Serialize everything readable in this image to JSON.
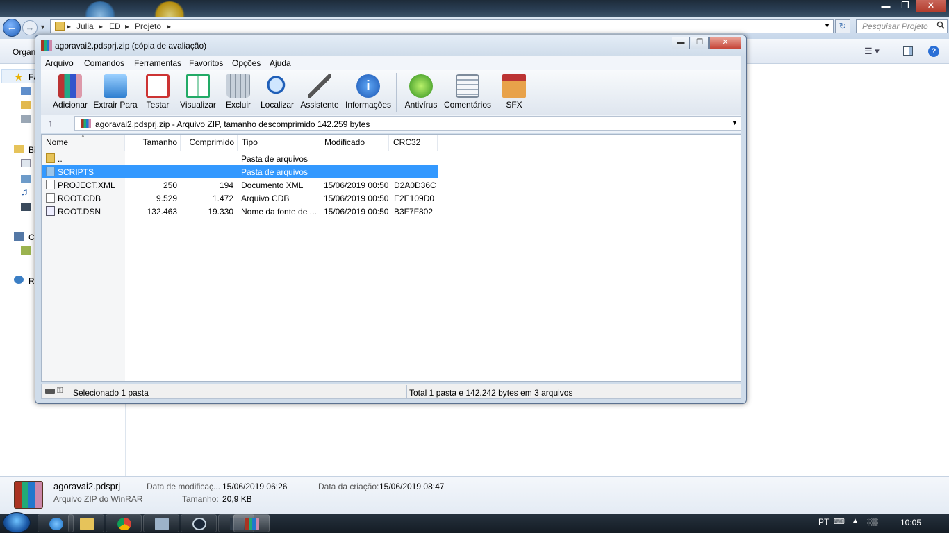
{
  "explorer": {
    "breadcrumbs": [
      "Julia",
      "ED",
      "Projeto"
    ],
    "search_placeholder": "Pesquisar Projeto",
    "organize_label": "Organ",
    "nav_labels": [
      "Fa",
      "Bi",
      "C",
      "Re"
    ],
    "window_controls": {
      "minimize": "▬",
      "maximize": "❐",
      "close": "✕"
    }
  },
  "details": {
    "filename": "agoravai2.pdsprj",
    "filetype": "Arquivo ZIP do WinRAR",
    "mod_label": "Data de modificaç...",
    "mod_value": "15/06/2019 06:26",
    "size_label": "Tamanho:",
    "size_value": "20,9 KB",
    "created_label": "Data da criação:",
    "created_value": "15/06/2019 08:47"
  },
  "winrar": {
    "title": "agoravai2.pdsprj.zip (cópia de avaliação)",
    "menu": [
      "Arquivo",
      "Comandos",
      "Ferramentas",
      "Favoritos",
      "Opções",
      "Ajuda"
    ],
    "tools": [
      {
        "label": "Adicionar",
        "icon": "books-icon"
      },
      {
        "label": "Extrair Para",
        "icon": "folder-extract-icon"
      },
      {
        "label": "Testar",
        "icon": "clipboard-check-icon"
      },
      {
        "label": "Visualizar",
        "icon": "open-book-icon"
      },
      {
        "label": "Excluir",
        "icon": "trash-icon"
      },
      {
        "label": "Localizar",
        "icon": "magnifier-icon"
      },
      {
        "label": "Assistente",
        "icon": "magic-wand-icon"
      },
      {
        "label": "Informações",
        "icon": "info-icon"
      },
      {
        "label": "Antivírus",
        "icon": "bug-shield-icon"
      },
      {
        "label": "Comentários",
        "icon": "comment-icon"
      },
      {
        "label": "SFX",
        "icon": "sfx-box-icon"
      }
    ],
    "path": "agoravai2.pdsprj.zip - Arquivo ZIP, tamanho descomprimido 142.259 bytes",
    "columns": [
      "Nome",
      "Tamanho",
      "Comprimido",
      "Tipo",
      "Modificado",
      "CRC32"
    ],
    "rows": [
      {
        "name": "..",
        "size": "",
        "packed": "",
        "type": "Pasta de arquivos",
        "modified": "",
        "crc": "",
        "icon": "folder-icon",
        "selected": false
      },
      {
        "name": "SCRIPTS",
        "size": "",
        "packed": "",
        "type": "Pasta de arquivos",
        "modified": "",
        "crc": "",
        "icon": "folder-icon",
        "selected": true
      },
      {
        "name": "PROJECT.XML",
        "size": "250",
        "packed": "194",
        "type": "Documento XML",
        "modified": "15/06/2019 00:50",
        "crc": "D2A0D36C",
        "icon": "xml-file-icon",
        "selected": false
      },
      {
        "name": "ROOT.CDB",
        "size": "9.529",
        "packed": "1.472",
        "type": "Arquivo CDB",
        "modified": "15/06/2019 00:50",
        "crc": "E2E109D0",
        "icon": "file-icon",
        "selected": false
      },
      {
        "name": "ROOT.DSN",
        "size": "132.463",
        "packed": "19.330",
        "type": "Nome da fonte de ...",
        "modified": "15/06/2019 00:50",
        "crc": "B3F7F802",
        "icon": "dsn-file-icon",
        "selected": false
      }
    ],
    "status_left": "Selecionado 1 pasta",
    "status_right": "Total 1 pasta e 142.242 bytes em 3 arquivos"
  },
  "taskbar": {
    "language": "PT",
    "time": "10:05",
    "apps": [
      "ie-icon",
      "explorer-icon",
      "chrome-icon",
      "calculator-icon",
      "steam-icon",
      "game-icon",
      "winrar-icon"
    ]
  }
}
